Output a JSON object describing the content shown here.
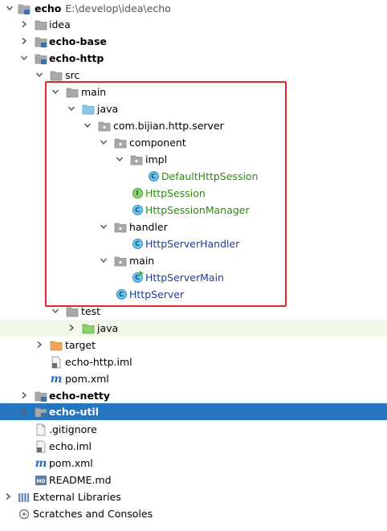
{
  "tree": {
    "root": {
      "label": "echo",
      "path": "E:\\develop\\idea\\echo"
    },
    "idea": "idea",
    "echo_base": "echo-base",
    "echo_http": "echo-http",
    "src": "src",
    "main": "main",
    "java": "java",
    "package": "com.bijian.http.server",
    "component": "component",
    "impl": "impl",
    "default_http_session": "DefaultHttpSession",
    "http_session": "HttpSession",
    "http_session_manager": "HttpSessionManager",
    "handler": "handler",
    "http_server_handler": "HttpServerHandler",
    "main_pkg": "main",
    "http_server_main": "HttpServerMain",
    "http_server": "HttpServer",
    "test": "test",
    "test_java": "java",
    "target": "target",
    "echo_http_iml": "echo-http.iml",
    "http_pom": "pom.xml",
    "echo_netty": "echo-netty",
    "echo_util": "echo-util",
    "gitignore": ".gitignore",
    "echo_iml": "echo.iml",
    "root_pom": "pom.xml",
    "readme": "README.md",
    "external_libraries": "External Libraries",
    "scratches": "Scratches and Consoles"
  },
  "colors": {
    "selection": "#2675bf",
    "highlight_border": "#e8232b",
    "test_bg": "#f1f8ea",
    "class_icon": "#6ec3e8",
    "interface_icon": "#8fd17a"
  }
}
